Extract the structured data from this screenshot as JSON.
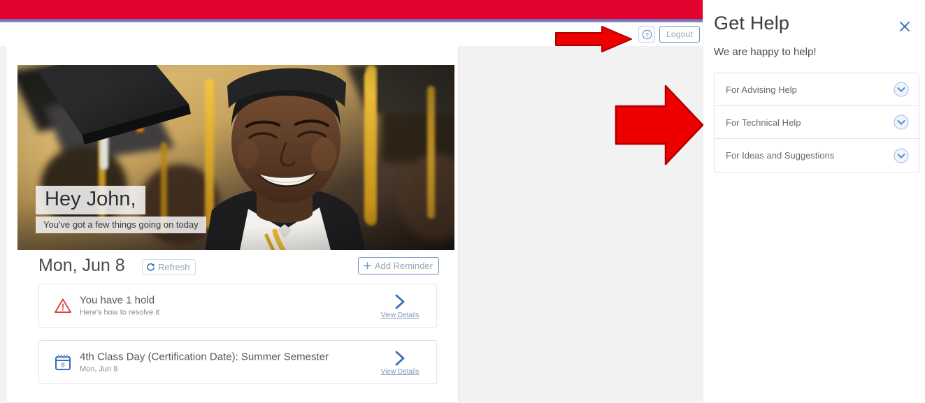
{
  "theme": {
    "banner_red": "#e3022f",
    "banner_rule_purple": "#6f6fb5",
    "page_grey": "#f2f2f2",
    "link_blue": "#3a6bb5",
    "accent_blue": "#6f8fc4",
    "alert_red": "#e04141",
    "annotation_arrow_red": "#ee0000"
  },
  "topbar": {
    "help_icon": "question-circle-icon",
    "logout_label": "Logout"
  },
  "hero": {
    "greeting": "Hey John,",
    "subtitle": "You've got a few things going on today",
    "image_description": "graduation-photo"
  },
  "dashboard": {
    "date_label": "Mon, Jun 8",
    "refresh_label": "Refresh",
    "refresh_icon": "refresh-icon",
    "add_reminder_label": "Add Reminder",
    "add_reminder_icon": "plus-icon",
    "cards": [
      {
        "icon": "warning-triangle-icon",
        "title": "You have 1 hold",
        "subtitle": "Here's how to resolve it",
        "action_label": "View Details",
        "action_icon": "chevron-right-icon"
      },
      {
        "icon": "calendar-icon",
        "icon_day": "8",
        "title": "4th Class Day (Certification Date): Summer Semester",
        "subtitle": "Mon, Jun 8",
        "action_label": "View Details",
        "action_icon": "chevron-right-icon"
      }
    ]
  },
  "help_panel": {
    "title": "Get Help",
    "close_icon": "close-icon",
    "subtitle": "We are happy to help!",
    "items": [
      {
        "label": "For Advising Help",
        "icon": "chevron-down-circle-icon"
      },
      {
        "label": "For Technical Help",
        "icon": "chevron-down-circle-icon"
      },
      {
        "label": "For Ideas and Suggestions",
        "icon": "chevron-down-circle-icon"
      }
    ]
  },
  "annotations": [
    {
      "name": "arrow-pointing-to-logout",
      "icon": "right-arrow-icon"
    },
    {
      "name": "arrow-pointing-to-get-help-panel",
      "icon": "right-arrow-icon"
    }
  ]
}
